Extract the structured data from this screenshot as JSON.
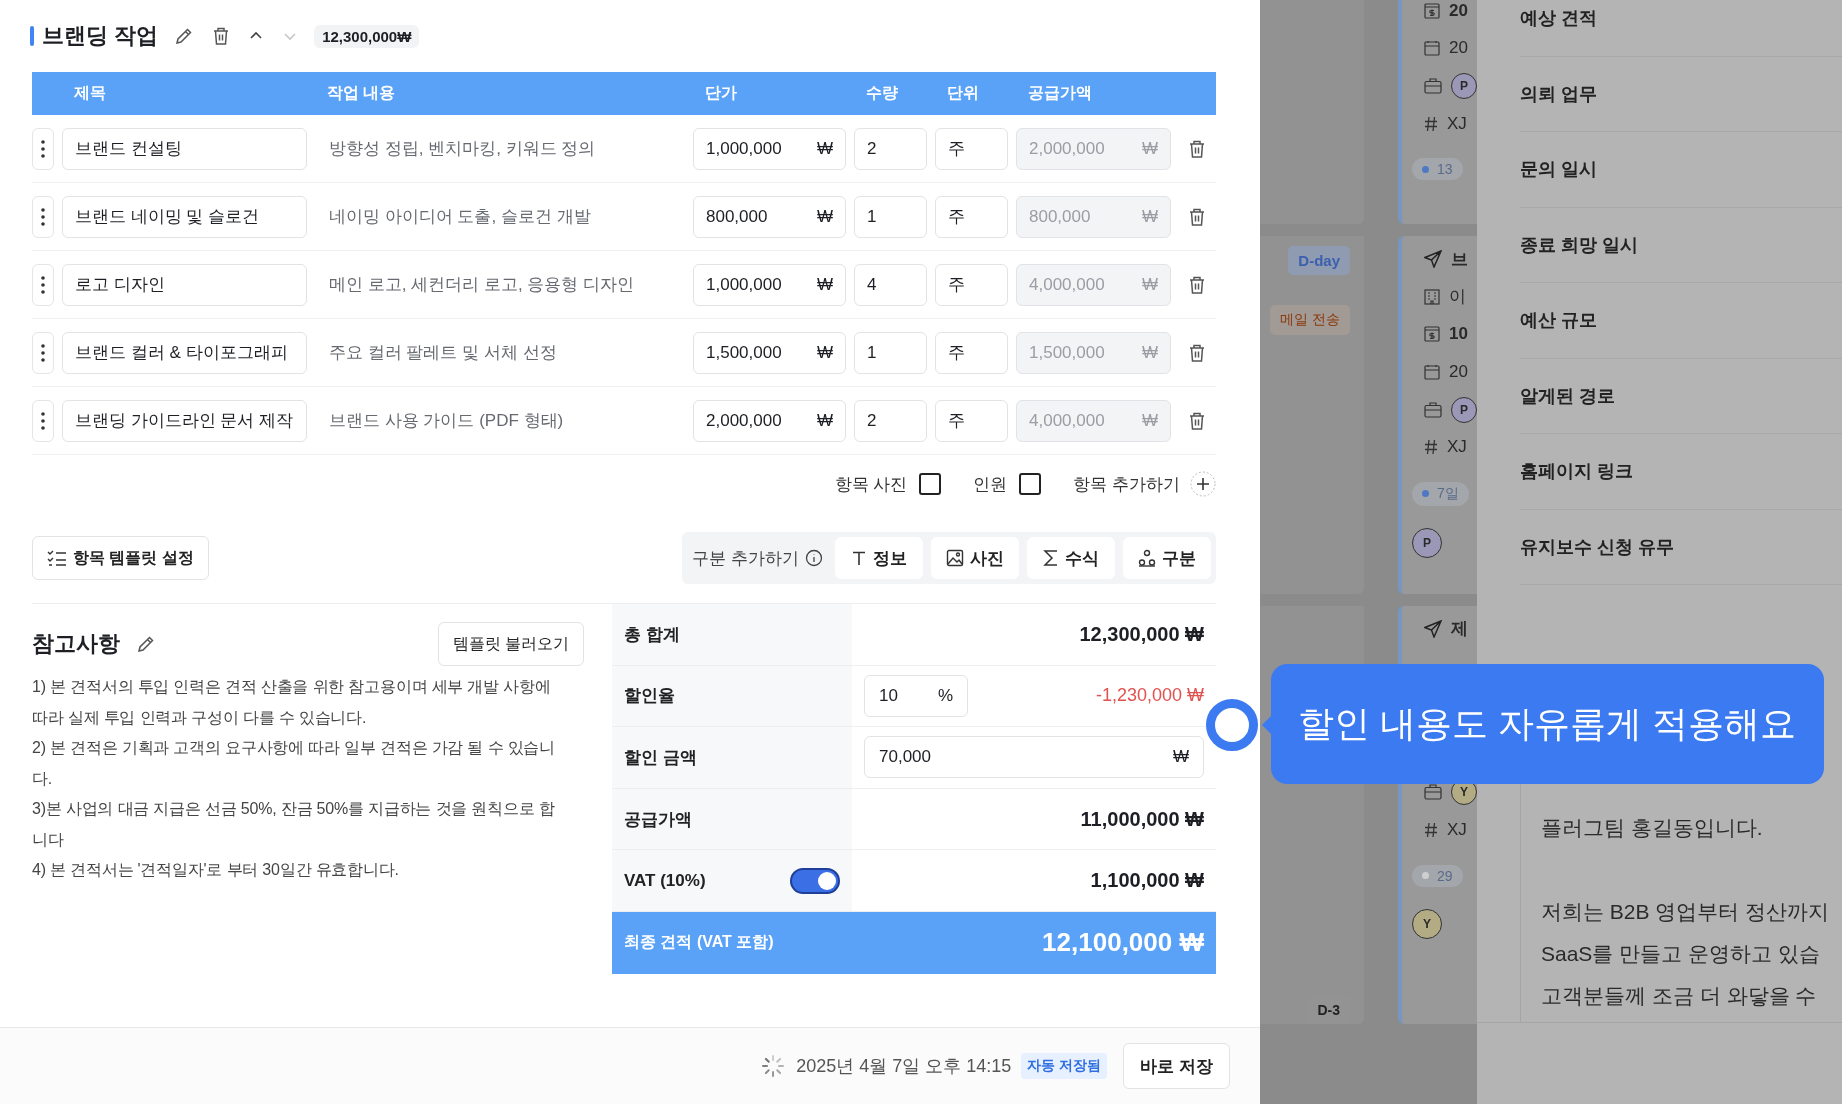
{
  "section": {
    "title": "브랜딩 작업",
    "total_badge": "12,300,000₩",
    "move_buttons": [
      {
        "kind": "up",
        "disabled": false
      },
      {
        "kind": "down",
        "disabled": true
      }
    ]
  },
  "table": {
    "columns": [
      "제목",
      "작업 내용",
      "단가",
      "수량",
      "단위",
      "공급가액"
    ],
    "rows": [
      {
        "title": "브랜드 컨설팅",
        "description": "방향성 정립, 벤치마킹, 키워드 정의",
        "unit_price": "1,000,000",
        "price_currency": "₩",
        "quantity": "2",
        "unit": "주",
        "amount": "2,000,000",
        "amount_currency": "₩"
      },
      {
        "title": "브랜드 네이밍 및 슬로건",
        "description": "네이밍 아이디어 도출, 슬로건 개발",
        "unit_price": "800,000",
        "price_currency": "₩",
        "quantity": "1",
        "unit": "주",
        "amount": "800,000",
        "amount_currency": "₩"
      },
      {
        "title": "로고 디자인",
        "description": "메인 로고, 세컨더리 로고, 응용형 디자인",
        "unit_price": "1,000,000",
        "price_currency": "₩",
        "quantity": "4",
        "unit": "주",
        "amount": "4,000,000",
        "amount_currency": "₩"
      },
      {
        "title": "브랜드 컬러 & 타이포그래피",
        "description": "주요 컬러 팔레트 및 서체 선정",
        "unit_price": "1,500,000",
        "price_currency": "₩",
        "quantity": "1",
        "unit": "주",
        "amount": "1,500,000",
        "amount_currency": "₩"
      },
      {
        "title": "브랜딩 가이드라인 문서 제작",
        "description": "브랜드 사용 가이드 (PDF 형태)",
        "unit_price": "2,000,000",
        "price_currency": "₩",
        "quantity": "2",
        "unit": "주",
        "amount": "4,000,000",
        "amount_currency": "₩"
      }
    ]
  },
  "item_options": [
    {
      "label": "항목 사진",
      "checked": false
    },
    {
      "label": "인원",
      "checked": false
    }
  ],
  "add_item": "항목 추가하기",
  "template_button": "항목 템플릿 설정",
  "section_add": {
    "label": "구분 추가하기",
    "buttons": [
      {
        "kind": "text",
        "label": "정보"
      },
      {
        "kind": "photo",
        "label": "사진"
      },
      {
        "kind": "formula",
        "label": "수식"
      },
      {
        "kind": "group",
        "label": "구분"
      }
    ]
  },
  "notes": {
    "title": "참고사항",
    "load_button": "템플릿 불러오기",
    "lines": [
      "1) 본 견적서의 투입 인력은 견적 산출을 위한 참고용이며 세부 개발 사항에 따라 실제 투입 인력과 구성이 다를 수 있습니다.",
      "2) 본 견적은 기획과 고객의 요구사항에 따라 일부 견적은 가감 될 수 있습니다.",
      "3)본 사업의 대금 지급은 선금 50%, 잔금 50%를 지급하는 것을 원칙으로 합니다",
      "4) 본 견적서는 '견적일자'로 부터 30일간 유효합니다."
    ]
  },
  "summary": {
    "rows": [
      {
        "kind": "plain",
        "label": "총 합계",
        "value": "12,300,000 ₩"
      },
      {
        "kind": "rate",
        "label": "할인율",
        "input": "10",
        "suffix": "%",
        "value": "-1,230,000 ₩"
      },
      {
        "kind": "amount",
        "label": "할인 금액",
        "input": "70,000",
        "suffix": "₩"
      },
      {
        "kind": "plain",
        "label": "공급가액",
        "value": "11,000,000 ₩"
      },
      {
        "kind": "toggle",
        "label": "VAT (10%)",
        "on": true,
        "value": "1,100,000 ₩"
      }
    ],
    "final": {
      "label": "최종 견적 (VAT 포함)",
      "value": "12,100,000 ₩"
    }
  },
  "footer": {
    "timestamp": "2025년 4월 7일 오후 14:15",
    "status_badge": "자동 저장됨",
    "save_button": "바로 저장"
  },
  "board": [
    {
      "lines": [
        {
          "kind": "amount",
          "text": "20"
        },
        {
          "kind": "date",
          "text": "20"
        },
        {
          "kind": "company",
          "avatar": "P",
          "color": "#9b97b6"
        },
        {
          "kind": "code",
          "text": "XJ"
        },
        {
          "kind": "chip",
          "text": "13",
          "color": "#4f78c4"
        }
      ]
    },
    {
      "tags": [
        {
          "kind": "dday",
          "label": "D-day"
        },
        {
          "kind": "mail",
          "label": "메일 전송"
        }
      ],
      "lines": [
        {
          "kind": "title",
          "text": "브"
        },
        {
          "kind": "building",
          "text": "이"
        },
        {
          "kind": "amount",
          "text": "10"
        },
        {
          "kind": "date",
          "text": "20"
        },
        {
          "kind": "company",
          "avatar": "P",
          "color": "#9b97b6"
        },
        {
          "kind": "code",
          "text": "XJ"
        },
        {
          "kind": "chip",
          "text": "7일",
          "color": "#4f78c4"
        },
        {
          "kind": "avatar",
          "avatar": "P",
          "color": "#9b97b6"
        }
      ]
    },
    {
      "tags": [
        {
          "kind": "plain",
          "label": "D-3"
        }
      ],
      "lines": [
        {
          "kind": "title",
          "text": "제"
        },
        {
          "kind": "company",
          "avatar": "Y",
          "color": "#b3ab84"
        },
        {
          "kind": "code",
          "text": "XJ"
        },
        {
          "kind": "chip",
          "text": "29",
          "color": "#cfcfcf"
        },
        {
          "kind": "avatar",
          "avatar": "Y",
          "color": "#b3ab84"
        }
      ]
    }
  ],
  "drawer": {
    "fields": [
      "예상 견적",
      "의뢰 업무",
      "문의 일시",
      "종료 희망 일시",
      "예산 규모",
      "알게된 경로",
      "홈페이지 링크",
      "유지보수 신청 유무"
    ],
    "message": [
      [
        "플러그팀 홍길동입니다."
      ],
      [
        "저희는 B2B 영업부터 정산까지",
        "SaaS를 만들고 운영하고 있습",
        "고객분들께 조금 더 와닿을 수"
      ]
    ]
  },
  "tooltip": "할인 내용도 자유롭게 적용해요"
}
